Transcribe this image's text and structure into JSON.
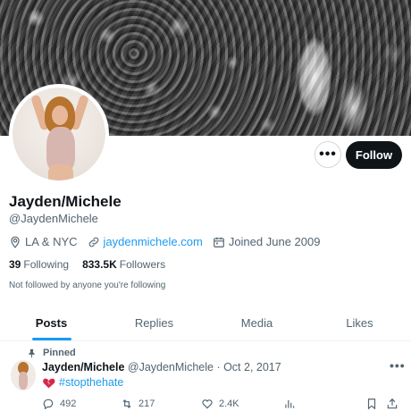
{
  "profile": {
    "name": "Jayden/Michele",
    "handle": "@JaydenMichele",
    "location": "LA & NYC",
    "website": "jaydenmichele.com",
    "joined": "Joined June 2009",
    "following_count": "39",
    "following_label": "Following",
    "followers_count": "833.5K",
    "followers_label": "Followers",
    "not_followed_text": "Not followed by anyone you're following"
  },
  "buttons": {
    "more": "•••",
    "follow": "Follow"
  },
  "tabs": [
    {
      "label": "Posts",
      "active": true
    },
    {
      "label": "Replies",
      "active": false
    },
    {
      "label": "Media",
      "active": false
    },
    {
      "label": "Likes",
      "active": false
    }
  ],
  "tweet": {
    "pinned_label": "Pinned",
    "author_name": "Jayden/Michele",
    "author_handle": "@JaydenMichele",
    "separator": " · ",
    "date": "Oct 2, 2017",
    "more": "•••",
    "emoji_icon": "broken-heart-icon",
    "hashtag": "#stopthehate",
    "replies": "492",
    "retweets": "217",
    "likes": "2.4K"
  },
  "colors": {
    "accent": "#1d9bf0",
    "text": "#0f1419",
    "muted": "#536471",
    "follow_button_bg": "#0f1419",
    "broken_heart": "#d9274b"
  }
}
